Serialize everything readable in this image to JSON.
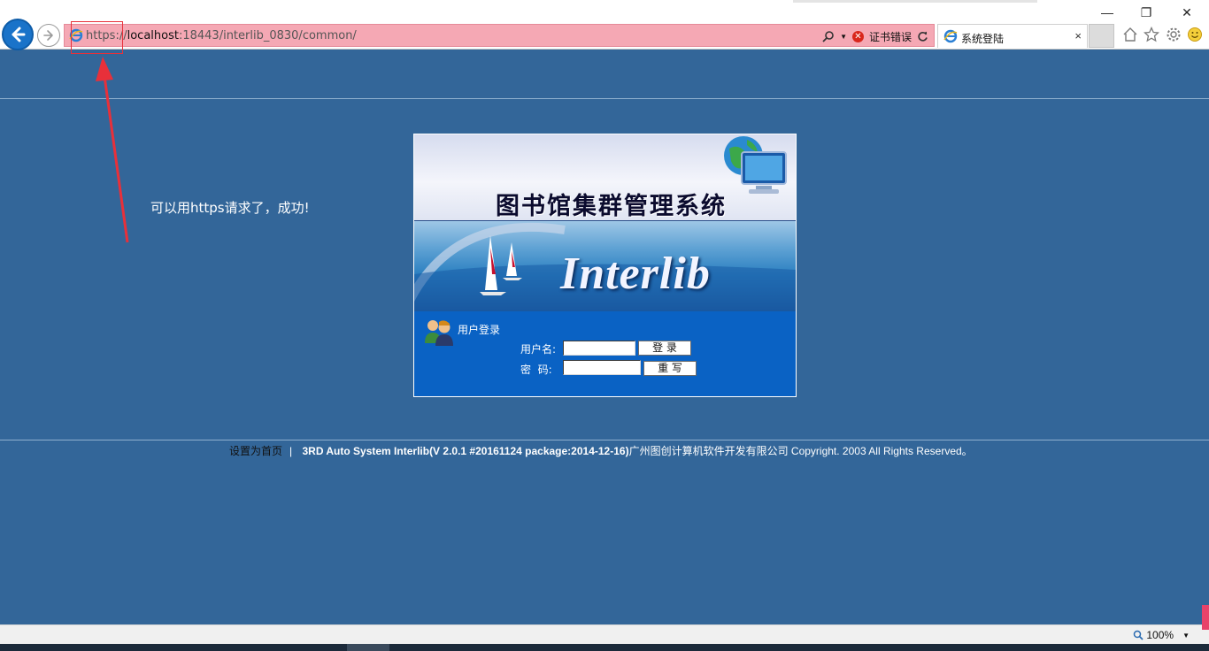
{
  "browser": {
    "url_scheme": "https://",
    "url_host": "localhost",
    "url_rest": ":18443/interlib_0830/common/",
    "cert_error_label": "证书错误",
    "tab_title": "系统登陆",
    "tab_close": "×",
    "zoom_level": "100%",
    "window_controls": {
      "minimize": "—",
      "restore": "❐",
      "close": "✕"
    },
    "icons": [
      "back-arrow-icon",
      "forward-arrow-icon",
      "ie-logo-icon",
      "search-icon",
      "refresh-icon",
      "home-icon",
      "favorites-star-icon",
      "settings-gear-icon",
      "smiley-feedback-icon",
      "zoom-icon"
    ]
  },
  "annotation": {
    "text": "可以用https请求了，成功!"
  },
  "login": {
    "banner_title": "图书馆集群管理系统",
    "banner_brand": "Interlib",
    "heading": "用户登录",
    "username_label": "用户名:",
    "password_label": "密  码:",
    "login_button": " 登 录 ",
    "reset_button": " 重 写 ",
    "username_value": "",
    "password_value": ""
  },
  "footer": {
    "set_homepage": "设置为首页",
    "separator": "|",
    "product": "3RD Auto System Interlib(V 2.0.1 #20161124 package:2014-12-16)",
    "company_copyright": "广州图创计算机软件开发有限公司 Copyright. 2003 All Rights Reserved。"
  },
  "colors": {
    "page_background": "#336699",
    "address_bar_error": "#f5a8b4",
    "annotation_box": "#e8303a",
    "login_panel": "#0a62c4"
  }
}
